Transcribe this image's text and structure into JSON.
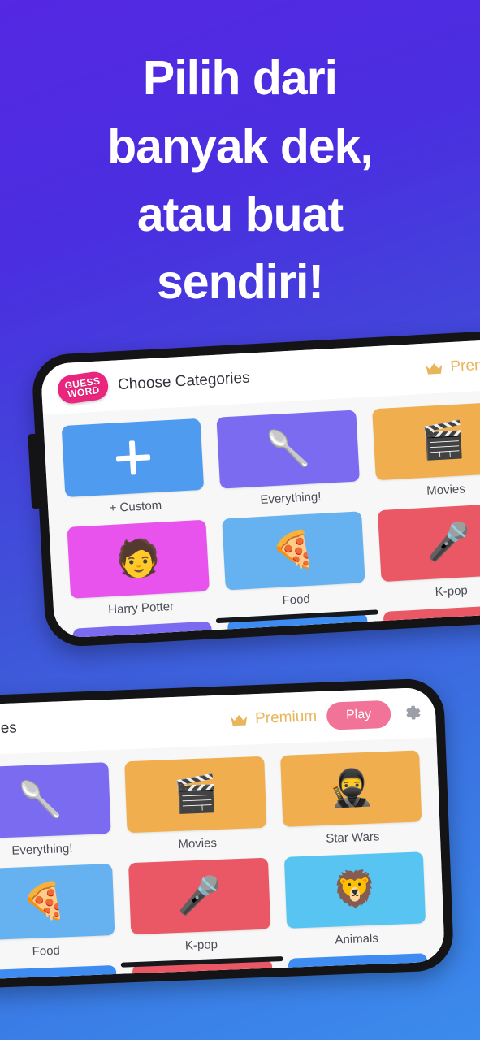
{
  "background": {
    "gradient_from": "#5528E2",
    "gradient_mid": "#3F52D8",
    "gradient_to": "#3B8BEC"
  },
  "headline": {
    "lines": [
      "Pilih dari",
      "banyak dek,",
      "atau buat",
      "sendiri!"
    ],
    "color": "#FFFFFF"
  },
  "phone_1": {
    "appbar": {
      "logo_line_1": "GUESS",
      "logo_line_2": "WORD",
      "logo_color": "#E9257E",
      "title": "Choose Categories",
      "premium_label": "Premium",
      "premium_color": "#E8B55A",
      "crown_icon": "crown-icon"
    },
    "categories": [
      {
        "label": "+ Custom",
        "color": "#4F9BF0",
        "icon": "plus-icon",
        "glyph": ""
      },
      {
        "label": "Everything!",
        "color": "#7B6BF0",
        "icon": "stand-mixer-icon",
        "glyph": "🥄"
      },
      {
        "label": "Movies",
        "color": "#F0AE4E",
        "icon": "clapperboard-icon",
        "glyph": "🎬"
      },
      {
        "label": "Harry Potter",
        "color": "#E853EE",
        "icon": "wizard-portrait-icon",
        "glyph": "🧑"
      },
      {
        "label": "Food",
        "color": "#66B2F0",
        "icon": "pizza-icon",
        "glyph": "🍕"
      },
      {
        "label": "K-pop",
        "color": "#EA5765",
        "icon": "microphone-icon",
        "glyph": "🎤"
      }
    ],
    "partial_row_colors": [
      "#7B6BF0",
      "#3E8CF2",
      "#EA5765"
    ]
  },
  "phone_2": {
    "appbar": {
      "title": "egories",
      "premium_label": "Premium",
      "premium_color": "#E8B55A",
      "crown_icon": "crown-icon",
      "play_label": "Play",
      "play_color": "#F27398",
      "settings_icon": "gear-icon"
    },
    "categories": [
      {
        "label": "Everything!",
        "color": "#7B6BF0",
        "icon": "stand-mixer-icon",
        "glyph": "🥄"
      },
      {
        "label": "Movies",
        "color": "#F0AE4E",
        "icon": "clapperboard-icon",
        "glyph": "🎬"
      },
      {
        "label": "Star Wars",
        "color": "#F0AE4E",
        "icon": "darth-vader-icon",
        "glyph": "🥷"
      },
      {
        "label": "Food",
        "color": "#66B2F0",
        "icon": "pizza-icon",
        "glyph": "🍕"
      },
      {
        "label": "K-pop",
        "color": "#EA5765",
        "icon": "microphone-icon",
        "glyph": "🎤"
      },
      {
        "label": "Animals",
        "color": "#57C4F2",
        "icon": "lion-icon",
        "glyph": "🦁"
      }
    ],
    "partial_row_colors": [
      "#3E8CF2",
      "#EA5765",
      "#3E8CF2"
    ]
  }
}
